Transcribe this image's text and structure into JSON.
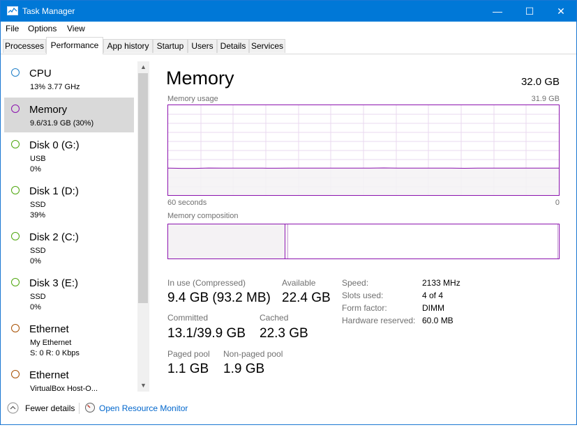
{
  "window": {
    "title": "Task Manager",
    "minimize": "—",
    "maximize": "☐",
    "close": "✕"
  },
  "menu": [
    "File",
    "Options",
    "View"
  ],
  "tabs": [
    "Processes",
    "Performance",
    "App history",
    "Startup",
    "Users",
    "Details",
    "Services"
  ],
  "active_tab": "Performance",
  "sidebar": [
    {
      "name": "CPU",
      "line2": "13%  3.77 GHz",
      "line3": "",
      "color": "#1e7ec8"
    },
    {
      "name": "Memory",
      "line2": "9.6/31.9 GB (30%)",
      "line3": "",
      "color": "#8b12ae"
    },
    {
      "name": "Disk 0 (G:)",
      "line2": "USB",
      "line3": "0%",
      "color": "#4da60c"
    },
    {
      "name": "Disk 1 (D:)",
      "line2": "SSD",
      "line3": "39%",
      "color": "#4da60c"
    },
    {
      "name": "Disk 2 (C:)",
      "line2": "SSD",
      "line3": "0%",
      "color": "#4da60c"
    },
    {
      "name": "Disk 3 (E:)",
      "line2": "SSD",
      "line3": "0%",
      "color": "#4da60c"
    },
    {
      "name": "Ethernet",
      "line2": "My Ethernet",
      "line3": "S: 0 R: 0 Kbps",
      "color": "#a74f01"
    },
    {
      "name": "Ethernet",
      "line2": "VirtualBox Host-O...",
      "line3": "",
      "color": "#a74f01"
    }
  ],
  "main": {
    "title": "Memory",
    "total": "32.0 GB",
    "usage_label": "Memory usage",
    "usage_max": "31.9 GB",
    "time_left": "60 seconds",
    "time_right": "0",
    "composition_label": "Memory composition",
    "usage_fraction": 0.3
  },
  "stats": {
    "in_use_label": "In use (Compressed)",
    "in_use": "9.4 GB (93.2 MB)",
    "available_label": "Available",
    "available": "22.4 GB",
    "committed_label": "Committed",
    "committed": "13.1/39.9 GB",
    "cached_label": "Cached",
    "cached": "22.3 GB",
    "paged_label": "Paged pool",
    "paged": "1.1 GB",
    "nonpaged_label": "Non-paged pool",
    "nonpaged": "1.9 GB"
  },
  "details": [
    {
      "label": "Speed:",
      "value": "2133 MHz"
    },
    {
      "label": "Slots used:",
      "value": "4 of 4"
    },
    {
      "label": "Form factor:",
      "value": "DIMM"
    },
    {
      "label": "Hardware reserved:",
      "value": "60.0 MB"
    }
  ],
  "footer": {
    "fewer_details": "Fewer details",
    "resource_monitor": "Open Resource Monitor"
  },
  "colors": {
    "accent": "#0078d7",
    "memory": "#8b12ae",
    "memory_fill": "#f4f2f4"
  }
}
